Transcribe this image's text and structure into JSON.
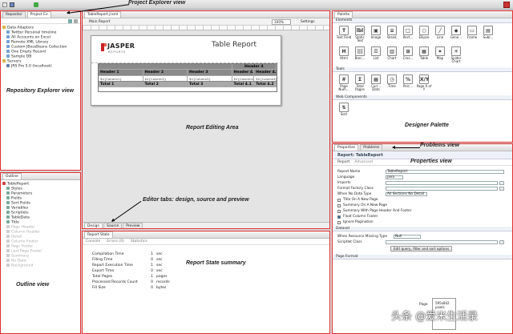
{
  "toolbar": {
    "right_icons": [
      "perspective-icon"
    ]
  },
  "repository": {
    "tabs": [
      "Repositor",
      "Project Ex"
    ],
    "items": [
      {
        "label": "Data Adapters",
        "level": 0,
        "icon": "folder-icon"
      },
      {
        "label": "Twitter Personal timeline",
        "level": 1,
        "icon": "adapter-icon"
      },
      {
        "label": "All Accounts on Excel",
        "level": 1,
        "icon": "adapter-icon"
      },
      {
        "label": "Remote XML Library",
        "level": 1,
        "icon": "adapter-icon"
      },
      {
        "label": "Custom JBossBeans Collection",
        "level": 1,
        "icon": "adapter-icon"
      },
      {
        "label": "One Empty Record",
        "level": 1,
        "icon": "adapter-icon"
      },
      {
        "label": "Sample DB",
        "level": 1,
        "icon": "adapter-icon"
      },
      {
        "label": "Servers",
        "level": 0,
        "icon": "folder-icon"
      },
      {
        "label": "JRS Pro 5.0 (localhost)",
        "level": 1,
        "icon": "server-icon"
      }
    ]
  },
  "outline": {
    "tab": "Outline",
    "items": [
      {
        "label": "TableReport",
        "level": 0,
        "dim": false
      },
      {
        "label": "Styles",
        "level": 1,
        "dim": false
      },
      {
        "label": "Parameters",
        "level": 1,
        "dim": false
      },
      {
        "label": "Fields",
        "level": 1,
        "dim": false
      },
      {
        "label": "Sort Fields",
        "level": 1,
        "dim": false
      },
      {
        "label": "Variables",
        "level": 1,
        "dim": false
      },
      {
        "label": "Scriptlets",
        "level": 1,
        "dim": false
      },
      {
        "label": "TableData",
        "level": 1,
        "dim": false
      },
      {
        "label": "Title",
        "level": 1,
        "dim": false
      },
      {
        "label": "Page Header",
        "level": 1,
        "dim": true
      },
      {
        "label": "Column Header",
        "level": 1,
        "dim": true
      },
      {
        "label": "Detail",
        "level": 1,
        "dim": true
      },
      {
        "label": "Column Footer",
        "level": 1,
        "dim": true
      },
      {
        "label": "Page Footer",
        "level": 1,
        "dim": true
      },
      {
        "label": "Last Page Footer",
        "level": 1,
        "dim": true
      },
      {
        "label": "Summary",
        "level": 1,
        "dim": true
      },
      {
        "label": "No Data",
        "level": 1,
        "dim": true
      },
      {
        "label": "Background",
        "level": 1,
        "dim": true
      }
    ]
  },
  "editor": {
    "tab": "TableReport.jrxml",
    "breadcrumb": "Main Report",
    "zoom": "100%",
    "settings": "Settings",
    "report": {
      "logo": "JASPER",
      "logo_sub": "REPORTS",
      "title": "Table Report",
      "group_header": "Header 4",
      "headers": [
        "Header 1",
        "Header 2",
        "Header 3",
        "",
        "Header 4.2"
      ],
      "header_sub": "Header 4.1",
      "fields": [
        "$V{Column1}",
        "$V{Column2}",
        "$V{Column3}",
        "$V{Column4}",
        "$V{Column4}"
      ],
      "totals": [
        "Total 1",
        "Total 2",
        "Total 3",
        "Total 4.1",
        "Total 4.2"
      ]
    },
    "bottom_tabs": [
      "Design",
      "Source",
      "Preview"
    ]
  },
  "report_state": {
    "tab": "Report State",
    "subtabs": [
      "Console",
      "Errors (0)",
      "Statistics"
    ],
    "rows": [
      {
        "label": "Compilation Time",
        "value": "1",
        "unit": "sec"
      },
      {
        "label": "Filling Time",
        "value": "0",
        "unit": "sec"
      },
      {
        "label": "Report Execution Time",
        "value": "1",
        "unit": "sec"
      },
      {
        "label": "Export Time",
        "value": "0",
        "unit": "sec"
      },
      {
        "label": "Total Pages",
        "value": "1",
        "unit": "pages"
      },
      {
        "label": "Processed Records Count",
        "value": "0",
        "unit": "records"
      },
      {
        "label": "Fill Size",
        "value": "0",
        "unit": "bytes"
      }
    ]
  },
  "palette": {
    "tab": "Palette",
    "sections": [
      {
        "title": "Elements",
        "items": [
          {
            "label": "Text Field",
            "glyph": "T"
          },
          {
            "label": "Static Text",
            "glyph": "lbl"
          },
          {
            "label": "Image",
            "glyph": "▣"
          },
          {
            "label": "Break",
            "glyph": "≡"
          },
          {
            "label": "Rect...",
            "glyph": "□"
          },
          {
            "label": "Ellipse",
            "glyph": "○"
          },
          {
            "label": "Line",
            "glyph": "╱"
          },
          {
            "label": "Gene...",
            "glyph": "◆"
          },
          {
            "label": "Frame",
            "glyph": "▭"
          },
          {
            "label": "Subr...",
            "glyph": "▤"
          },
          {
            "label": "Html",
            "glyph": "H"
          },
          {
            "label": "Barc...",
            "glyph": "|||"
          },
          {
            "label": "List",
            "glyph": "☰"
          },
          {
            "label": "Chart",
            "glyph": "▥"
          },
          {
            "label": "Cros...",
            "glyph": "⊞"
          },
          {
            "label": "Table",
            "glyph": "▦"
          },
          {
            "label": "Map",
            "glyph": "⌖"
          },
          {
            "label": "Spider Chart",
            "glyph": "✳"
          }
        ]
      },
      {
        "title": "Tools",
        "items": [
          {
            "label": "Page Num...",
            "glyph": "#"
          },
          {
            "label": "Total Pages",
            "glyph": "Σ"
          },
          {
            "label": "Curr... Date",
            "glyph": "▦"
          },
          {
            "label": "Time",
            "glyph": "◷"
          },
          {
            "label": "Perc...",
            "glyph": "%"
          },
          {
            "label": "Page X of Y",
            "glyph": "X/Y"
          }
        ]
      },
      {
        "title": "Web Components",
        "items": [
          {
            "label": "Sort",
            "glyph": "⇅"
          }
        ]
      }
    ]
  },
  "properties": {
    "tabs": [
      "Properties",
      "Problems"
    ],
    "title": "Report: TableReport",
    "subtabs": [
      "Report",
      "Advanced"
    ],
    "fields": {
      "report_name_label": "Report Name",
      "report_name": "TableReport",
      "language_label": "Language",
      "language": "java",
      "imports_label": "Imports",
      "format_factory_label": "Format Factory Class",
      "when_no_data_label": "When No Data Type",
      "when_no_data": "All Sections No Detail"
    },
    "checks": [
      {
        "label": "Title On A New Page",
        "checked": false
      },
      {
        "label": "Summary On A New Page",
        "checked": false
      },
      {
        "label": "Summary With Page Header And Footer",
        "checked": false
      },
      {
        "label": "Float Column Footer",
        "checked": true
      },
      {
        "label": "Ignore Pagination",
        "checked": false
      }
    ],
    "dataset_title": "Dataset",
    "when_resource_missing_label": "When Resource Missing Type",
    "when_resource_missing": "Null",
    "scriptlet_label": "Scriptlet Class",
    "edit_query_button": "Edit query, filter and sort options",
    "page_format_title": "Page Format",
    "page_size": "595x842",
    "page_size_unit": "pixels",
    "page_label": "Page"
  },
  "annotations": {
    "project_explorer": "Project Explorer view",
    "repository_explorer": "Repository Explorer view",
    "outline": "Outline view",
    "editing_area": "Report Editing Area",
    "editor_tabs": "Editor tabs: design, source and preview",
    "report_state": "Report State summary",
    "designer_palette": "Designer Palette",
    "problems": "Problems view",
    "properties": "Properties view"
  },
  "watermark": "头条 @爱米生活录",
  "colors": {
    "annotation_border": "#e03030",
    "header_cell": "#8a8a8a",
    "total_cell": "#a8a8a8",
    "selection": "#3a7bd5"
  }
}
